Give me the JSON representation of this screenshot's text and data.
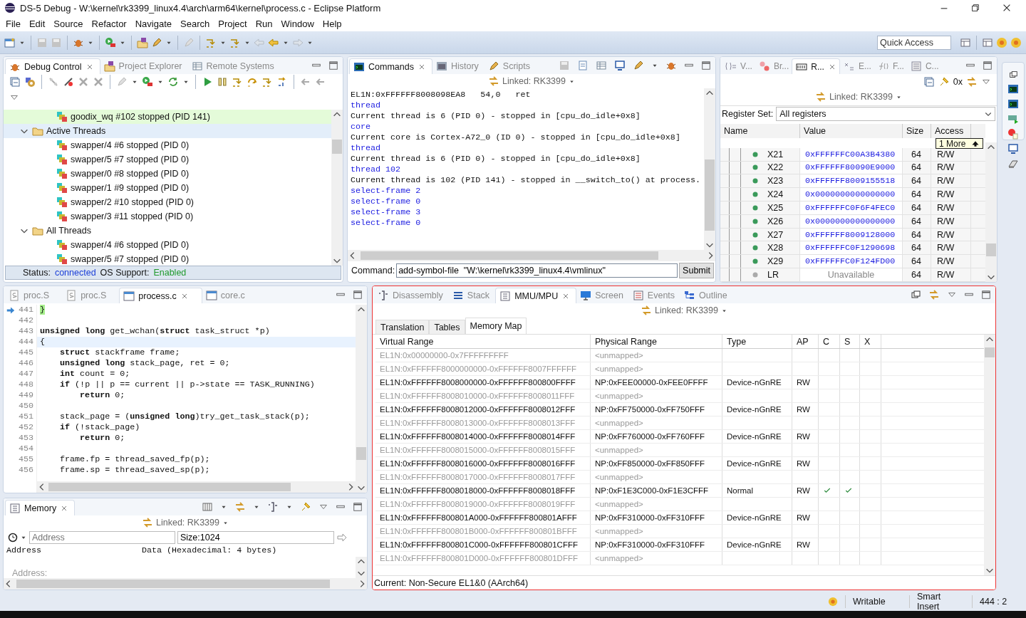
{
  "window": {
    "title": "DS-5 Debug - W:\\kernel\\rk3399_linux4.4\\arch\\arm64\\kernel\\process.c - Eclipse Platform"
  },
  "menu": [
    "File",
    "Edit",
    "Source",
    "Refactor",
    "Navigate",
    "Search",
    "Project",
    "Run",
    "Window",
    "Help"
  ],
  "quick_access": {
    "placeholder": "Quick Access"
  },
  "debug_control": {
    "tabs": [
      {
        "label": "Debug Control",
        "selected": true
      },
      {
        "label": "Project Explorer",
        "selected": false
      },
      {
        "label": "Remote Systems",
        "selected": false
      }
    ],
    "tree": [
      {
        "label": "goodix_wq #102 stopped (PID 141)",
        "kind": "thread",
        "current": true,
        "selected": false
      },
      {
        "label": "Active Threads",
        "kind": "folder",
        "expanded": true,
        "current": false,
        "selected": true,
        "children": [
          {
            "label": "swapper/4 #6 stopped (PID 0)",
            "kind": "thread",
            "current": false,
            "selected": false
          },
          {
            "label": "swapper/5 #7 stopped (PID 0)",
            "kind": "thread",
            "current": false,
            "selected": false
          },
          {
            "label": "swapper/0 #8 stopped (PID 0)",
            "kind": "thread",
            "current": false,
            "selected": false
          },
          {
            "label": "swapper/1 #9 stopped (PID 0)",
            "kind": "thread",
            "current": false,
            "selected": false
          },
          {
            "label": "swapper/2 #10 stopped (PID 0)",
            "kind": "thread",
            "current": false,
            "selected": false
          },
          {
            "label": "swapper/3 #11 stopped (PID 0)",
            "kind": "thread",
            "current": false,
            "selected": false
          }
        ]
      },
      {
        "label": "All Threads",
        "kind": "folder",
        "expanded": true,
        "current": false,
        "selected": false,
        "children": [
          {
            "label": "swapper/4 #6 stopped (PID 0)",
            "kind": "thread",
            "current": false,
            "selected": false
          },
          {
            "label": "swapper/5 #7 stopped (PID 0)",
            "kind": "thread",
            "current": false,
            "selected": false
          }
        ]
      }
    ],
    "status": {
      "label": "Status:",
      "value": "connected",
      "os_label": "OS Support:",
      "os_value": "Enabled"
    }
  },
  "commands": {
    "tabs": [
      {
        "label": "Commands",
        "selected": true
      },
      {
        "label": "History",
        "selected": false
      },
      {
        "label": "Scripts",
        "selected": false
      }
    ],
    "linked": "Linked: RK3399",
    "lines": [
      {
        "text": "EL1N:0xFFFFFF8008098EA8   54,0   ret",
        "kind": "output"
      },
      {
        "text": "thread",
        "kind": "input"
      },
      {
        "text": "Current thread is 6 (PID 0) - stopped in [cpu_do_idle+0x8]",
        "kind": "output"
      },
      {
        "text": "core",
        "kind": "input"
      },
      {
        "text": "Current core is Cortex-A72_0 (ID 0) - stopped in [cpu_do_idle+0x8]",
        "kind": "output"
      },
      {
        "text": "thread",
        "kind": "input"
      },
      {
        "text": "Current thread is 6 (PID 0) - stopped in [cpu_do_idle+0x8]",
        "kind": "output"
      },
      {
        "text": "thread 102",
        "kind": "input"
      },
      {
        "text": "Current thread is 102 (PID 141) - stopped in __switch_to() at process.",
        "kind": "output"
      },
      {
        "text": "select-frame 2",
        "kind": "input"
      },
      {
        "text": "select-frame 0",
        "kind": "input"
      },
      {
        "text": "select-frame 3",
        "kind": "input"
      },
      {
        "text": "select-frame 0",
        "kind": "input"
      }
    ],
    "command_label": "Command:",
    "command_value": "add-symbol-file  \"W:\\kernel\\rk3399_linux4.4\\vmlinux\"",
    "submit": "Submit"
  },
  "registers": {
    "tabs": [
      {
        "label": "V...",
        "selected": false
      },
      {
        "label": "Br...",
        "selected": false
      },
      {
        "label": "R...",
        "selected": true
      },
      {
        "label": "E...",
        "selected": false
      },
      {
        "label": "F...",
        "selected": false
      },
      {
        "label": "C...",
        "selected": false
      }
    ],
    "format_button": "0x",
    "linked": "Linked: RK3399",
    "set_label": "Register Set:",
    "set_value": "All registers",
    "columns": [
      "Name",
      "Value",
      "Size",
      "Access"
    ],
    "rows": [
      {
        "name": "X21",
        "value": "0xFFFFFFC00A3B4380",
        "size": "64",
        "access": "R/W",
        "available": true
      },
      {
        "name": "X22",
        "value": "0xFFFFFF80090E9000",
        "size": "64",
        "access": "R/W",
        "available": true
      },
      {
        "name": "X23",
        "value": "0xFFFFFF8009155518",
        "size": "64",
        "access": "R/W",
        "available": true
      },
      {
        "name": "X24",
        "value": "0x0000000000000000",
        "size": "64",
        "access": "R/W",
        "available": true
      },
      {
        "name": "X25",
        "value": "0xFFFFFFC0F6F4FEC0",
        "size": "64",
        "access": "R/W",
        "available": true
      },
      {
        "name": "X26",
        "value": "0x0000000000000000",
        "size": "64",
        "access": "R/W",
        "available": true
      },
      {
        "name": "X27",
        "value": "0xFFFFFF8009128000",
        "size": "64",
        "access": "R/W",
        "available": true
      },
      {
        "name": "X28",
        "value": "0xFFFFFFC0F1290698",
        "size": "64",
        "access": "R/W",
        "available": true
      },
      {
        "name": "X29",
        "value": "0xFFFFFFC0F124FD00",
        "size": "64",
        "access": "R/W",
        "available": true
      },
      {
        "name": "LR",
        "value": "Unavailable",
        "size": "64",
        "access": "R/W",
        "available": false
      }
    ],
    "tooltip": "1 More"
  },
  "editor": {
    "tabs": [
      {
        "label": "proc.S",
        "selected": false
      },
      {
        "label": "proc.S",
        "selected": false
      },
      {
        "label": "process.c",
        "selected": true
      },
      {
        "label": "core.c",
        "selected": false
      }
    ],
    "lines": [
      {
        "number": "441",
        "code": "}",
        "pc": true,
        "cursor": false
      },
      {
        "number": "442",
        "pc": false,
        "cursor": false
      },
      {
        "number": "443",
        "code": "**unsigned** **long** get_wchan(**struct** task_struct *p)",
        "pc": false,
        "cursor": false
      },
      {
        "number": "444",
        "code": "{",
        "pc": false,
        "cursor": true
      },
      {
        "number": "445",
        "code": "    **struct** stackframe frame;",
        "pc": false,
        "cursor": false
      },
      {
        "number": "446",
        "code": "    **unsigned** **long** stack_page, ret = 0;",
        "pc": false,
        "cursor": false
      },
      {
        "number": "447",
        "code": "    **int** count = 0;",
        "pc": false,
        "cursor": false
      },
      {
        "number": "448",
        "code": "    **if** (!p || p == current || p->state == TASK_RUNNING)",
        "pc": false,
        "cursor": false
      },
      {
        "number": "449",
        "code": "        **return** 0;",
        "pc": false,
        "cursor": false
      },
      {
        "number": "450",
        "pc": false,
        "cursor": false
      },
      {
        "number": "451",
        "code": "    stack_page = (**unsigned** **long**)try_get_task_stack(p);",
        "pc": false,
        "cursor": false
      },
      {
        "number": "452",
        "code": "    **if** (!stack_page)",
        "pc": false,
        "cursor": false
      },
      {
        "number": "453",
        "code": "        **return** 0;",
        "pc": false,
        "cursor": false
      },
      {
        "number": "454",
        "pc": false,
        "cursor": false
      },
      {
        "number": "455",
        "code": "    frame.fp = thread_saved_fp(p);",
        "pc": false,
        "cursor": false
      },
      {
        "number": "456",
        "code": "    frame.sp = thread_saved_sp(p);",
        "pc": false,
        "cursor": false
      }
    ]
  },
  "memory": {
    "tabs": [
      {
        "label": "Memory",
        "selected": true
      }
    ],
    "linked": "Linked: RK3399",
    "address_placeholder": "Address",
    "size_value": "Size:1024",
    "columns": [
      "Address",
      "Data (Hexadecimal: 4 bytes)"
    ],
    "body_label": "Address:"
  },
  "mmu": {
    "tabs": [
      {
        "label": "Disassembly",
        "selected": false
      },
      {
        "label": "Stack",
        "selected": false
      },
      {
        "label": "MMU/MPU",
        "selected": true
      },
      {
        "label": "Screen",
        "selected": false
      },
      {
        "label": "Events",
        "selected": false
      },
      {
        "label": "Outline",
        "selected": false
      }
    ],
    "linked": "Linked: RK3399",
    "subtabs": [
      {
        "label": "Translation",
        "selected": false
      },
      {
        "label": "Tables",
        "selected": false
      },
      {
        "label": "Memory Map",
        "selected": true
      }
    ],
    "columns": [
      "Virtual Range",
      "Physical Range",
      "Type",
      "AP",
      "C",
      "S",
      "X"
    ],
    "rows": [
      {
        "virtual": "EL1N:0x00000000-0x7FFFFFFFFF",
        "physical": "<unmapped>",
        "mapped": false,
        "c": false,
        "s": false,
        "x": false
      },
      {
        "virtual": "EL1N:0xFFFFFF8000000000-0xFFFFFF8007FFFFFF",
        "physical": "<unmapped>",
        "mapped": false,
        "c": false,
        "s": false,
        "x": false
      },
      {
        "virtual": "EL1N:0xFFFFFF8008000000-0xFFFFFF800800FFFF",
        "physical": "NP:0xFEE00000-0xFEE0FFFF",
        "type": "Device-nGnRE",
        "ap": "RW",
        "mapped": true,
        "c": false,
        "s": false,
        "x": false
      },
      {
        "virtual": "EL1N:0xFFFFFF8008010000-0xFFFFFF8008011FFF",
        "physical": "<unmapped>",
        "mapped": false,
        "c": false,
        "s": false,
        "x": false
      },
      {
        "virtual": "EL1N:0xFFFFFF8008012000-0xFFFFFF8008012FFF",
        "physical": "NP:0xFF750000-0xFF750FFF",
        "type": "Device-nGnRE",
        "ap": "RW",
        "mapped": true,
        "c": false,
        "s": false,
        "x": false
      },
      {
        "virtual": "EL1N:0xFFFFFF8008013000-0xFFFFFF8008013FFF",
        "physical": "<unmapped>",
        "mapped": false,
        "c": false,
        "s": false,
        "x": false
      },
      {
        "virtual": "EL1N:0xFFFFFF8008014000-0xFFFFFF8008014FFF",
        "physical": "NP:0xFF760000-0xFF760FFF",
        "type": "Device-nGnRE",
        "ap": "RW",
        "mapped": true,
        "c": false,
        "s": false,
        "x": false
      },
      {
        "virtual": "EL1N:0xFFFFFF8008015000-0xFFFFFF8008015FFF",
        "physical": "<unmapped>",
        "mapped": false,
        "c": false,
        "s": false,
        "x": false
      },
      {
        "virtual": "EL1N:0xFFFFFF8008016000-0xFFFFFF8008016FFF",
        "physical": "NP:0xFF850000-0xFF850FFF",
        "type": "Device-nGnRE",
        "ap": "RW",
        "mapped": true,
        "c": false,
        "s": false,
        "x": false
      },
      {
        "virtual": "EL1N:0xFFFFFF8008017000-0xFFFFFF8008017FFF",
        "physical": "<unmapped>",
        "mapped": false,
        "c": false,
        "s": false,
        "x": false
      },
      {
        "virtual": "EL1N:0xFFFFFF8008018000-0xFFFFFF8008018FFF",
        "physical": "NP:0xF1E3C000-0xF1E3CFFF",
        "type": "Normal",
        "ap": "RW",
        "mapped": true,
        "c": true,
        "s": true,
        "x": false
      },
      {
        "virtual": "EL1N:0xFFFFFF8008019000-0xFFFFFF8008019FFF",
        "physical": "<unmapped>",
        "mapped": false,
        "c": false,
        "s": false,
        "x": false
      },
      {
        "virtual": "EL1N:0xFFFFFF800801A000-0xFFFFFF800801AFFF",
        "physical": "NP:0xFF310000-0xFF310FFF",
        "type": "Device-nGnRE",
        "ap": "RW",
        "mapped": true,
        "c": false,
        "s": false,
        "x": false
      },
      {
        "virtual": "EL1N:0xFFFFFF800801B000-0xFFFFFF800801BFFF",
        "physical": "<unmapped>",
        "mapped": false,
        "c": false,
        "s": false,
        "x": false
      },
      {
        "virtual": "EL1N:0xFFFFFF800801C000-0xFFFFFF800801CFFF",
        "physical": "NP:0xFF310000-0xFF310FFF",
        "type": "Device-nGnRE",
        "ap": "RW",
        "mapped": true,
        "c": false,
        "s": false,
        "x": false
      },
      {
        "virtual": "EL1N:0xFFFFFF800801D000-0xFFFFFF800801DFFF",
        "physical": "<unmapped>",
        "mapped": false,
        "c": false,
        "s": false,
        "x": false
      }
    ],
    "footer": "Current: Non-Secure EL1&0 (AArch64)"
  },
  "status_bar": [
    "Writable",
    "Smart Insert",
    "444 : 2"
  ]
}
